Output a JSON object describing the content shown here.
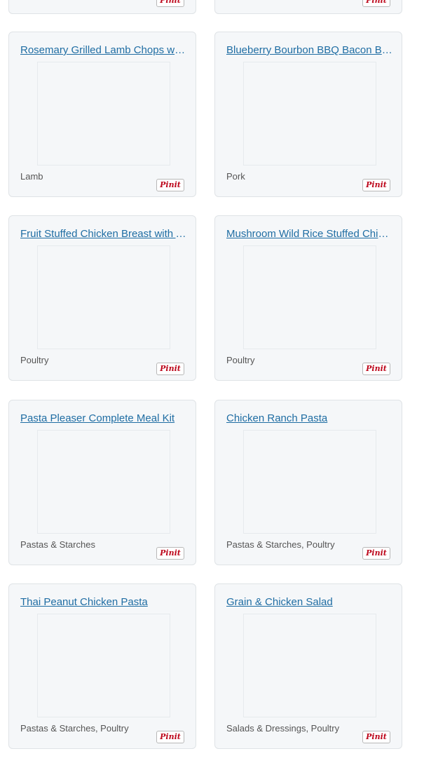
{
  "partial_cards": [
    {
      "pin_label": "Pinit"
    },
    {
      "pin_label": "Pinit"
    }
  ],
  "cards": [
    {
      "title": "Rosemary Grilled Lamb Chops with Mint Sauce",
      "category": "Lamb",
      "pin_label": "Pinit"
    },
    {
      "title": "Blueberry Bourbon BBQ Bacon Burgers",
      "category": "Pork",
      "pin_label": "Pinit"
    },
    {
      "title": "Fruit Stuffed Chicken Breast with Apricot Glaze",
      "category": "Poultry",
      "pin_label": "Pinit"
    },
    {
      "title": "Mushroom Wild Rice Stuffed Chicken Breast",
      "category": "Poultry",
      "pin_label": "Pinit"
    },
    {
      "title": "Pasta Pleaser Complete Meal Kit",
      "category": "Pastas & Starches",
      "pin_label": "Pinit"
    },
    {
      "title": "Chicken Ranch Pasta",
      "category": "Pastas & Starches, Poultry",
      "pin_label": "Pinit"
    },
    {
      "title": "Thai Peanut Chicken Pasta",
      "category": "Pastas & Starches, Poultry",
      "pin_label": "Pinit"
    },
    {
      "title": "Grain & Chicken Salad",
      "category": "Salads & Dressings, Poultry",
      "pin_label": "Pinit"
    }
  ]
}
